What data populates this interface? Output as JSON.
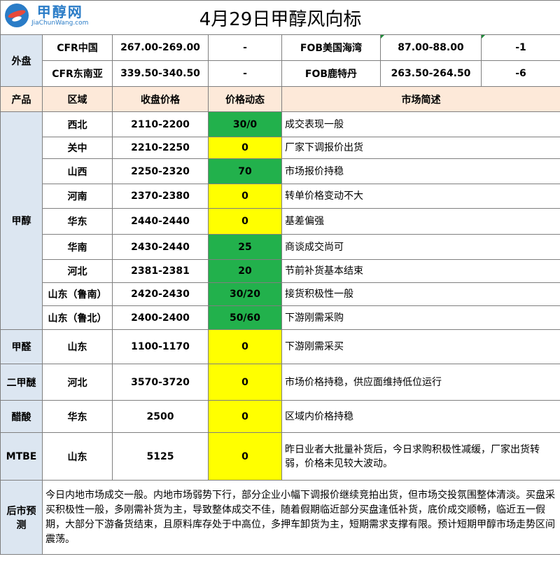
{
  "header": {
    "logo_cn": "甲醇网",
    "logo_en": "JiaChunWang.com",
    "title": "4月29日甲醇风向标"
  },
  "external": {
    "label": "外盘",
    "rows": [
      {
        "left_name": "CFR中国",
        "left_price": "267.00-269.00",
        "left_change": "-",
        "right_name": "FOB美国海湾",
        "right_price": "87.00-88.00",
        "right_change": "-1"
      },
      {
        "left_name": "CFR东南亚",
        "left_price": "339.50-340.50",
        "left_change": "-",
        "right_name": "FOB鹿特丹",
        "right_price": "263.50-264.50",
        "right_change": "-6"
      }
    ]
  },
  "columns": {
    "product": "产品",
    "region": "区域",
    "price": "收盘价格",
    "change": "价格动态",
    "summary": "市场简述"
  },
  "methanol": {
    "product": "甲醇",
    "rows": [
      {
        "region": "西北",
        "price": "2110-2200",
        "change": "30/0",
        "summary": "成交表现一般",
        "status": "up"
      },
      {
        "region": "关中",
        "price": "2210-2250",
        "change": "0",
        "summary": "厂家下调报价出货",
        "status": "flat"
      },
      {
        "region": "山西",
        "price": "2250-2320",
        "change": "70",
        "summary": "市场报价持稳",
        "status": "up"
      },
      {
        "region": "河南",
        "price": "2370-2380",
        "change": "0",
        "summary": "转单价格变动不大",
        "status": "flat"
      },
      {
        "region": "华东",
        "price": "2440-2440",
        "change": "0",
        "summary": "基差偏强",
        "status": "flat"
      },
      {
        "region": "华南",
        "price": "2430-2440",
        "change": "25",
        "summary": "商谈成交尚可",
        "status": "up"
      },
      {
        "region": "河北",
        "price": "2381-2381",
        "change": "20",
        "summary": "节前补货基本结束",
        "status": "up"
      },
      {
        "region": "山东（鲁南）",
        "price": "2420-2430",
        "change": "30/20",
        "summary": "接货积极性一般",
        "status": "up"
      },
      {
        "region": "山东（鲁北）",
        "price": "2400-2400",
        "change": "50/60",
        "summary": "下游刚需采购",
        "status": "up"
      }
    ]
  },
  "others": [
    {
      "product": "甲醛",
      "region": "山东",
      "price": "1100-1170",
      "change": "0",
      "summary": "下游刚需采买",
      "status": "flat"
    },
    {
      "product": "二甲醚",
      "region": "河北",
      "price": "3570-3720",
      "change": "0",
      "summary": "市场价格持稳，供应面维持低位运行",
      "status": "flat"
    },
    {
      "product": "醋酸",
      "region": "华东",
      "price": "2500",
      "change": "0",
      "summary": "区域内价格持稳",
      "status": "flat"
    },
    {
      "product": "MTBE",
      "region": "山东",
      "price": "5125",
      "change": "0",
      "summary": "昨日业者大批量补货后，今日求购积极性减缓，厂家出货转弱，价格未见较大波动。",
      "status": "flat"
    }
  ],
  "forecast": {
    "label": "后市预测",
    "text": "今日内地市场成交一般。内地市场弱势下行，部分企业小幅下调报价继续竞拍出货，但市场交投氛围整体清淡。买盘采买积极性一般，多刚需补货为主，导致整体成交不佳，随着假期临近部分买盘逢低补货，底价成交顺畅，临近五一假期，大部分下游备货结束，且原料库存处于中高位，多押车卸货为主，短期需求支撑有限。预计短期甲醇市场走势区间震荡。"
  },
  "colors": {
    "up": "#22b14c",
    "flat": "#ffff00",
    "label_bg": "#dce6f1",
    "header_bg": "#fde9d9"
  }
}
